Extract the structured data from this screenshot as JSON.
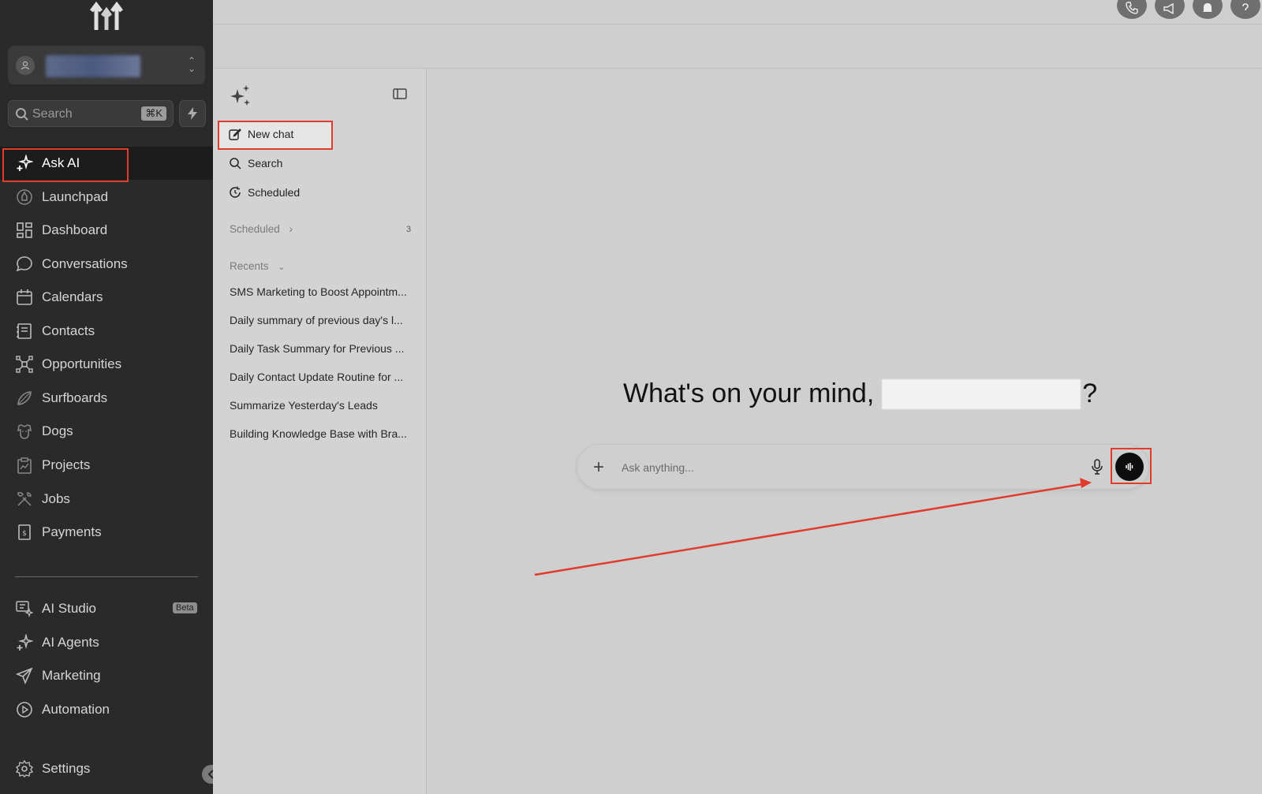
{
  "sidebar": {
    "search_placeholder": "Search",
    "search_shortcut": "⌘K",
    "items": [
      {
        "label": "Ask AI",
        "icon": "sparkle-icon"
      },
      {
        "label": "Launchpad",
        "icon": "rocket-icon"
      },
      {
        "label": "Dashboard",
        "icon": "grid-icon"
      },
      {
        "label": "Conversations",
        "icon": "chat-bubble-icon"
      },
      {
        "label": "Calendars",
        "icon": "calendar-icon"
      },
      {
        "label": "Contacts",
        "icon": "contacts-book-icon"
      },
      {
        "label": "Opportunities",
        "icon": "network-icon"
      },
      {
        "label": "Surfboards",
        "icon": "surfboard-icon"
      },
      {
        "label": "Dogs",
        "icon": "dog-icon"
      },
      {
        "label": "Projects",
        "icon": "clipboard-icon"
      },
      {
        "label": "Jobs",
        "icon": "tools-icon"
      },
      {
        "label": "Payments",
        "icon": "receipt-icon"
      }
    ],
    "lower_items": [
      {
        "label": "AI Studio",
        "icon": "ai-studio-icon",
        "badge": "Beta"
      },
      {
        "label": "AI Agents",
        "icon": "sparkle-icon"
      },
      {
        "label": "Marketing",
        "icon": "send-icon"
      },
      {
        "label": "Automation",
        "icon": "play-circle-icon"
      }
    ],
    "settings_label": "Settings"
  },
  "panel": {
    "new_chat": "New chat",
    "search": "Search",
    "scheduled": "Scheduled",
    "scheduled_section": "Scheduled",
    "scheduled_count": "3",
    "recents_section": "Recents",
    "recents": [
      "SMS Marketing to Boost Appointm...",
      "Daily summary of previous day's l...",
      "Daily Task Summary for Previous ...",
      "Daily Contact Update Routine for ...",
      "Summarize Yesterday's Leads",
      "Building Knowledge Base with Bra..."
    ]
  },
  "main": {
    "greeting_prefix": "What's on your mind,",
    "greeting_suffix": "?",
    "ask_placeholder": "Ask anything..."
  },
  "colors": {
    "highlight": "#e23b2e",
    "sidebar_bg": "#2a2a2a"
  }
}
